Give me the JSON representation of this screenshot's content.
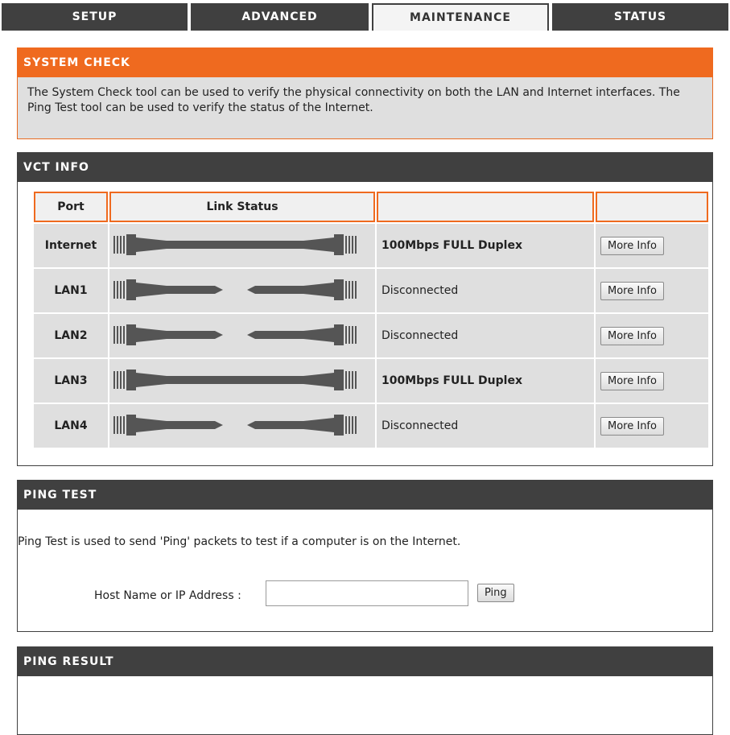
{
  "nav": {
    "tabs": [
      {
        "label": "SETUP"
      },
      {
        "label": "ADVANCED"
      },
      {
        "label": "MAINTENANCE"
      },
      {
        "label": "STATUS"
      }
    ],
    "active_tab": "MAINTENANCE"
  },
  "system_check": {
    "title": "SYSTEM CHECK",
    "description": "The System Check tool can be used to verify the physical connectivity on both the LAN and Internet interfaces. The Ping Test tool can be used to verify the status of the Internet."
  },
  "vct": {
    "title": "VCT INFO",
    "headers": {
      "port": "Port",
      "link_status": "Link Status",
      "col3": "",
      "col4": ""
    },
    "rows": [
      {
        "port": "Internet",
        "connected": true,
        "status": "100Mbps FULL Duplex",
        "button": "More Info"
      },
      {
        "port": "LAN1",
        "connected": false,
        "status": "Disconnected",
        "button": "More Info"
      },
      {
        "port": "LAN2",
        "connected": false,
        "status": "Disconnected",
        "button": "More Info"
      },
      {
        "port": "LAN3",
        "connected": true,
        "status": "100Mbps FULL Duplex",
        "button": "More Info"
      },
      {
        "port": "LAN4",
        "connected": false,
        "status": "Disconnected",
        "button": "More Info"
      }
    ]
  },
  "ping_test": {
    "title": "PING TEST",
    "description": "Ping Test is used to send 'Ping' packets to test if a computer is on the Internet.",
    "host_label": "Host Name or IP Address :",
    "host_value": "",
    "button": "Ping"
  },
  "ping_result": {
    "title": "PING RESULT"
  },
  "colors": {
    "accent": "#ef6a1f",
    "dark": "#404040",
    "panel": "#dfdfdf"
  }
}
